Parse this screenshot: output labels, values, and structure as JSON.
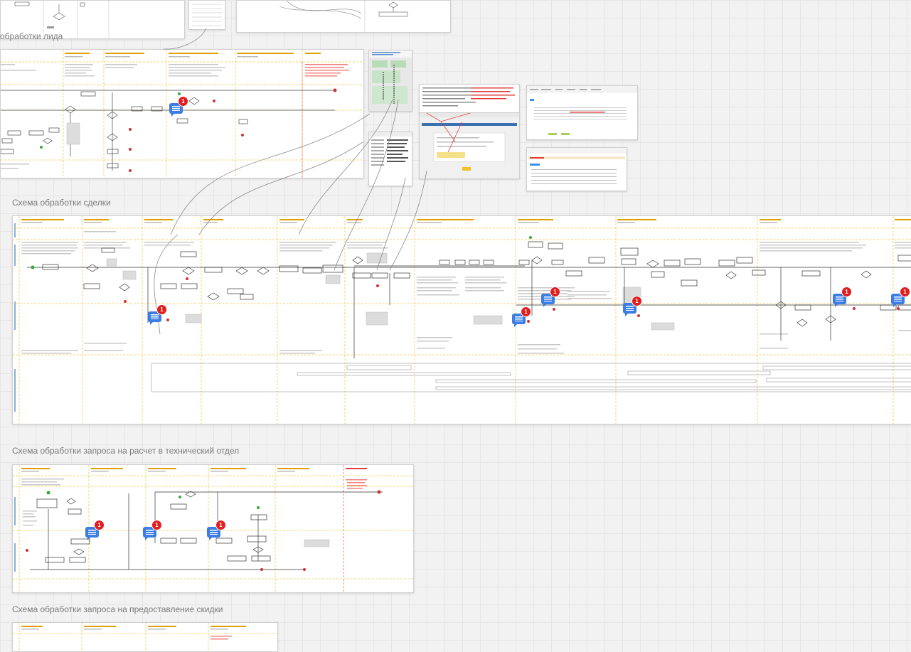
{
  "sections": {
    "lead": "обработки лида",
    "deal": "Схема обработки сделки",
    "tech_request": "Схема обработки запроса на расчет в технический отдел",
    "discount_request": "Схема обработки запроса на предоставление скидки"
  },
  "comment_badges": [
    {
      "count": "1"
    },
    {
      "count": "1"
    },
    {
      "count": "1"
    },
    {
      "count": "1"
    },
    {
      "count": "1"
    },
    {
      "count": "1"
    },
    {
      "count": "1"
    },
    {
      "count": "1"
    },
    {
      "count": "1"
    },
    {
      "count": "1"
    }
  ],
  "colors": {
    "lane_header_text": "#e0a000",
    "lane_divider": "#f5c84a",
    "error_text": "#e23b3b",
    "badge_blue": "#3b7de3",
    "badge_red": "#e01e1e",
    "connector_gray": "#8a8a8a"
  }
}
